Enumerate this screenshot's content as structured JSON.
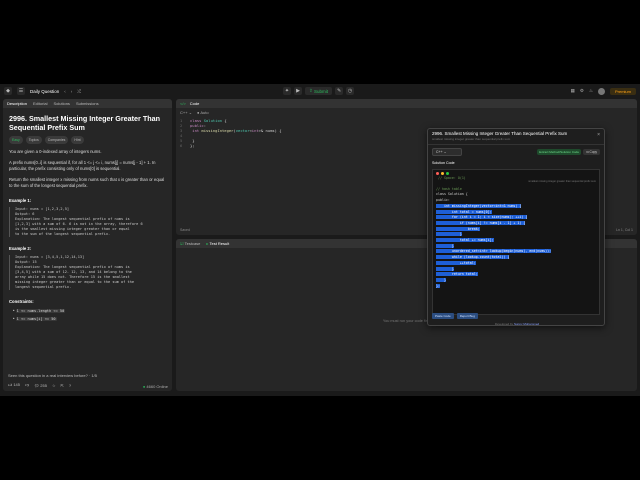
{
  "topbar": {
    "title": "Daily Question",
    "submit": "Submit",
    "premium": "Premium"
  },
  "left": {
    "tabs": [
      "Description",
      "Editorial",
      "Solutions",
      "Submissions"
    ],
    "title": "2996. Smallest Missing Integer Greater Than Sequential Prefix Sum",
    "chips": [
      "Easy",
      "Topics",
      "Companies",
      "Hint"
    ],
    "p1": "You are given a 0-indexed array of integers nums.",
    "p2": "A prefix nums[0..i] is sequential if, for all 1 <= j <= i, nums[j] = nums[j - 1] + 1. In particular, the prefix consisting only of nums[0] is sequential.",
    "p3": "Return the smallest integer x missing from nums such that x is greater than or equal to the sum of the longest sequential prefix.",
    "ex1_h": "Example 1:",
    "ex1": [
      "Input: nums = [1,2,3,2,5]",
      "Output: 6",
      "Explanation: The longest sequential prefix of nums is",
      "[1,2,3] with a sum of 6. 6 is not in the array, therefore 6",
      "is the smallest missing integer greater than or equal",
      "to the sum of the longest sequential prefix."
    ],
    "ex2_h": "Example 2:",
    "ex2": [
      "Input: nums = [3,4,5,1,12,14,13]",
      "Output: 15",
      "Explanation: The longest sequential prefix of nums is",
      "[3,4,5] with a sum of 12. 12, 13, and 14 belong to the",
      "array while 15 does not. Therefore 15 is the smallest",
      "missing integer greater than or equal to the sum of the",
      "longest sequential prefix."
    ],
    "cons_h": "Constraints:",
    "cons": [
      "1 <= nums.length <= 50",
      "1 <= nums[i] <= 50"
    ],
    "foot_q": "Seen this question in a real interview before?",
    "foot_ratio": "1/5",
    "likes": "145",
    "comments": "255",
    "online": "4660 Online"
  },
  "code": {
    "header": "Code",
    "lang": "C++",
    "auto": "Auto",
    "lines": [
      "class Solution {",
      "public:",
      "    int missingInteger(vector<int>& nums) {",
      "        ",
      "    }",
      "};"
    ],
    "saved": "Saved",
    "pos": "Ln 1, Col 1"
  },
  "test": {
    "tabs": [
      "Testcase",
      "Test Result"
    ],
    "msg": "You must run your code first"
  },
  "popup": {
    "title": "2996. Smallest Missing Integer Greater Than Sequential Prefix Sum",
    "subtitle": "smallest missing integer greater than sequential prefix sum",
    "lang": "C++",
    "green": "Extract Method/Solution Code",
    "copy": "Copy",
    "label": "Solution Code",
    "comment": "// Space: O(1)",
    "overlay": "smallest missing integer greater than sequential prefix sum",
    "code": [
      "// hash table",
      "class Solution {",
      "public:",
      "    int missingInteger(vector<int>& nums) {",
      "        int total = nums[0];",
      "        for (int i = 1; i < size(nums); ++i) {",
      "            if (nums[i] != nums[i - 1] + 1) {",
      "                break;",
      "            }",
      "            total += nums[i];",
      "        }",
      "        unordered_set<int> lookup(begin(nums), end(nums));",
      "        while (lookup.count(total)) {",
      "            ++total;",
      "        }",
      "        return total;",
      "    }",
      "};"
    ],
    "btns": [
      "Paste Code",
      "Report Bug"
    ],
    "dev_prefix": "Developed by ",
    "dev": "Sunny Mohammed"
  }
}
